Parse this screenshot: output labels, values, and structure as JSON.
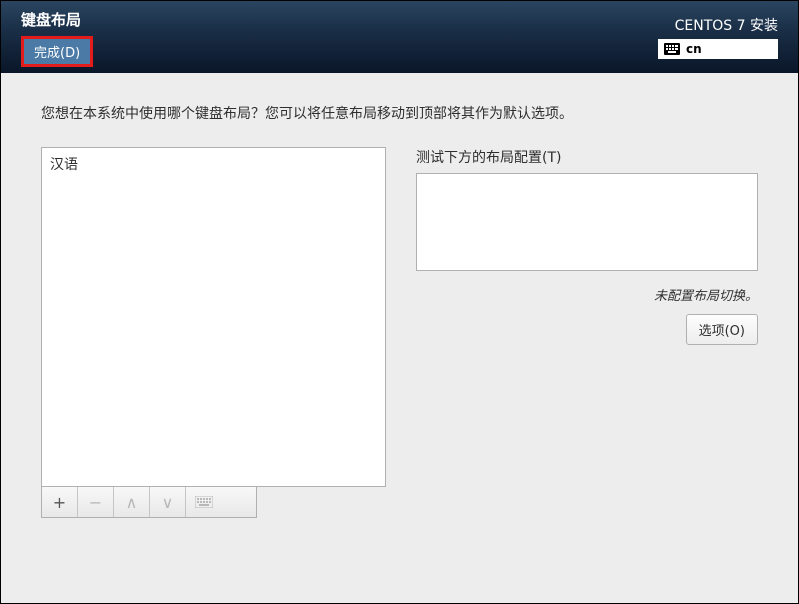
{
  "header": {
    "title": "键盘布局",
    "done_label": "完成(D)",
    "installer_title": "CENTOS 7 安装",
    "lang_code": "cn"
  },
  "instruction": "您想在本系统中使用哪个键盘布局？您可以将任意布局移动到顶部将其作为默认选项。",
  "layouts": [
    "汉语"
  ],
  "toolbar": {
    "add": "+",
    "remove": "−",
    "up": "∧",
    "down": "∨"
  },
  "right": {
    "test_label": "测试下方的布局配置(T)",
    "switch_status": "未配置布局切换。",
    "options_label": "选项(O)"
  }
}
